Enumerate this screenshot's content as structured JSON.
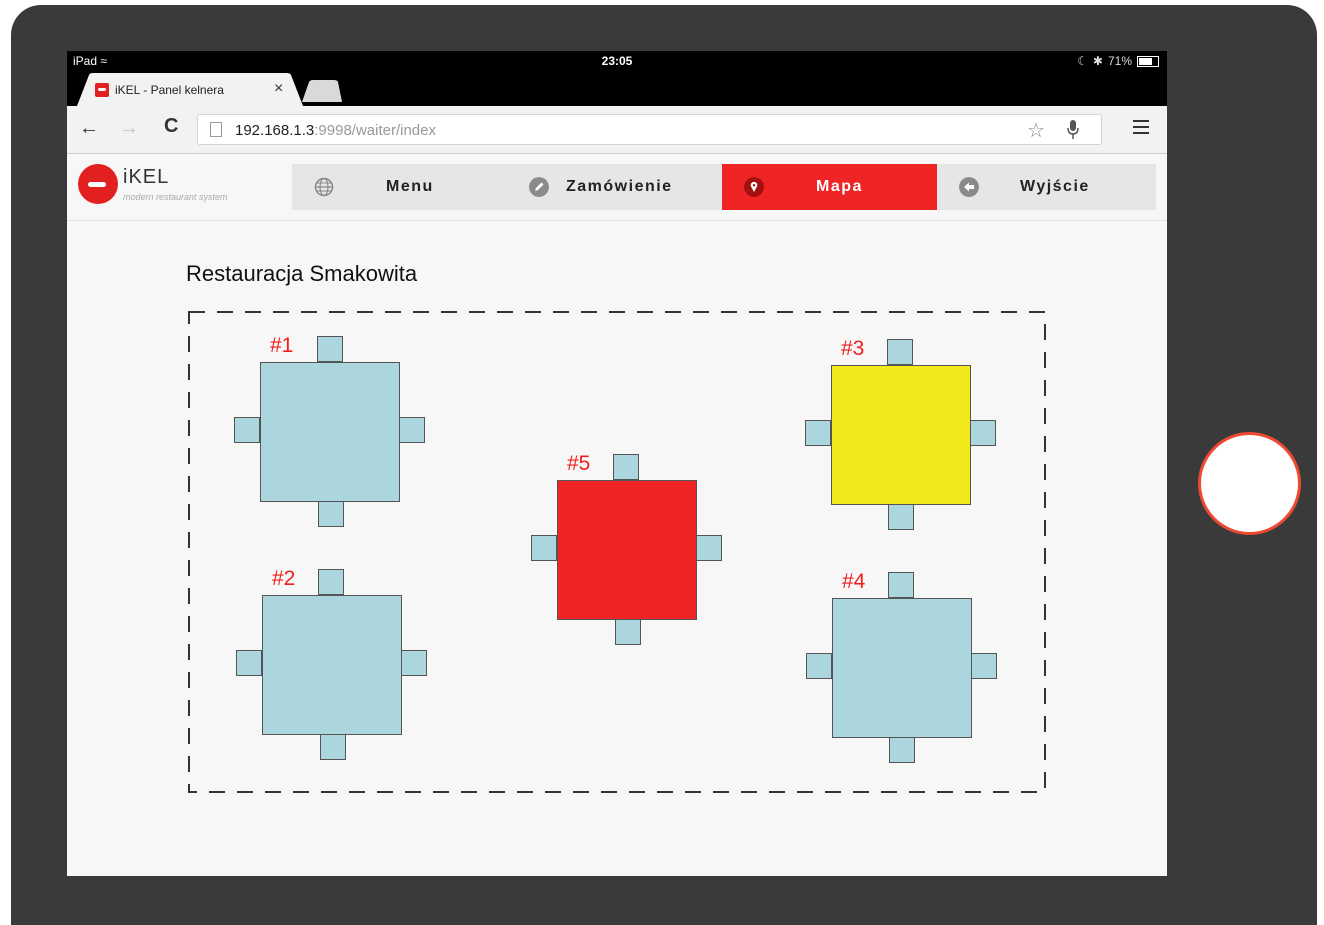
{
  "status_bar": {
    "device": "iPad",
    "time": "23:05",
    "battery": "71%"
  },
  "browser": {
    "tab_title": "iKEL - Panel kelnera",
    "tab_close": "×",
    "url_host": "192.168.1.3",
    "url_path": ":9998/waiter/index"
  },
  "app": {
    "logo_name": "iKEL",
    "logo_subtitle": "modern restaurant system",
    "nav": [
      {
        "label": "Menu",
        "icon": "globe-icon",
        "active": false
      },
      {
        "label": "Zamówienie",
        "icon": "pencil-icon",
        "active": false
      },
      {
        "label": "Mapa",
        "icon": "map-pin-icon",
        "active": true
      },
      {
        "label": "Wyjście",
        "icon": "arrow-left-icon",
        "active": false
      }
    ],
    "accent_color": "#ef2424"
  },
  "floor": {
    "title": "Restauracja Smakowita",
    "tables": [
      {
        "label": "#1",
        "color": "#acd6dd",
        "status": "free"
      },
      {
        "label": "#2",
        "color": "#acd6dd",
        "status": "free"
      },
      {
        "label": "#3",
        "color": "#f2e81c",
        "status": "yellow"
      },
      {
        "label": "#4",
        "color": "#acd6dd",
        "status": "free"
      },
      {
        "label": "#5",
        "color": "#ef2424",
        "status": "red"
      }
    ]
  }
}
